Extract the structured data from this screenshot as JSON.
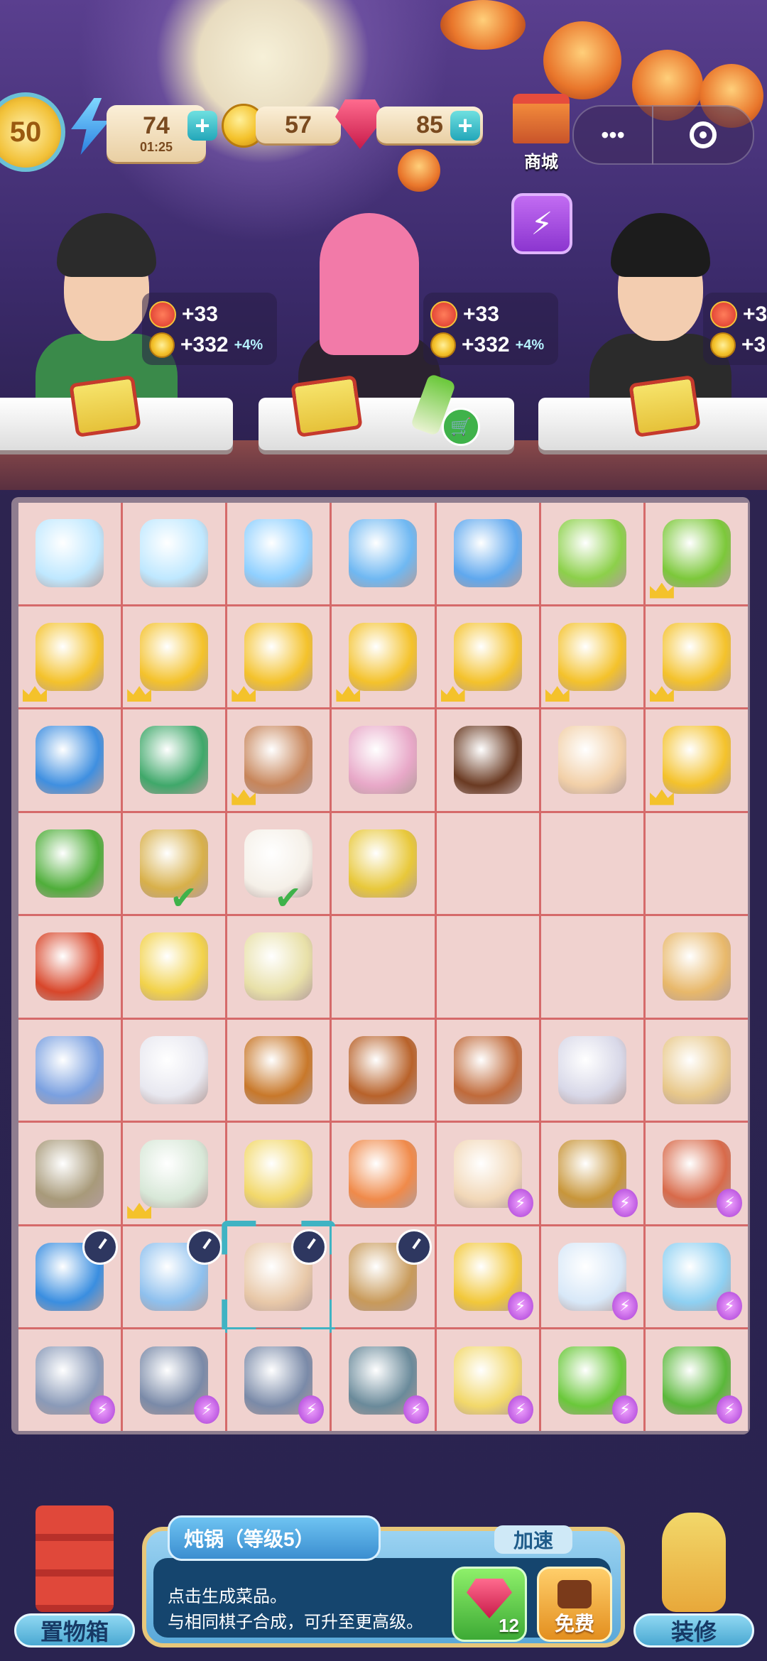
{
  "hud": {
    "level": "50",
    "energy": "74",
    "energy_timer": "01:25",
    "coins": "57",
    "gems": "85",
    "shop_label": "商城",
    "menu_dots": "•••"
  },
  "customers": [
    {
      "envelope_bonus": "+33",
      "coin_bonus": "+332",
      "coin_pct": "+4%"
    },
    {
      "envelope_bonus": "+33",
      "coin_bonus": "+332",
      "coin_pct": "+4%"
    },
    {
      "envelope_bonus": "+3",
      "coin_bonus": "+3",
      "coin_pct": ""
    }
  ],
  "board": {
    "rows": [
      [
        {
          "i": "ice-cube-icon",
          "c": "#bfe8ff"
        },
        {
          "i": "ice-cubes-icon",
          "c": "#bfe8ff"
        },
        {
          "i": "ice-bowl-icon",
          "c": "#8fd0ff"
        },
        {
          "i": "ice-bucket-icon",
          "c": "#6fb8f2"
        },
        {
          "i": "ice-cooler-icon",
          "c": "#5fa8ee"
        },
        {
          "i": "juicer-icon",
          "c": "#8cd04a"
        },
        {
          "i": "lime-icon",
          "c": "#7cc83a",
          "crown": true
        }
      ],
      [
        {
          "i": "coin-stack-icon",
          "c": "#f4c22b",
          "crown": true
        },
        {
          "i": "coin-stack-icon",
          "c": "#f4c22b",
          "crown": true
        },
        {
          "i": "coin-stack-icon",
          "c": "#f4c22b",
          "crown": true
        },
        {
          "i": "coin-stack-icon",
          "c": "#f4c22b",
          "crown": true
        },
        {
          "i": "coin-stack-icon",
          "c": "#f4c22b",
          "crown": true
        },
        {
          "i": "coin-stack-icon",
          "c": "#f4c22b",
          "crown": true
        },
        {
          "i": "coin-stack-icon",
          "c": "#f4c22b",
          "crown": true
        }
      ],
      [
        {
          "i": "blue-orb-icon",
          "c": "#3f8fe0"
        },
        {
          "i": "green-orb-icon",
          "c": "#3fa86a"
        },
        {
          "i": "dessert-bowl-icon",
          "c": "#c7855a",
          "crown": true
        },
        {
          "i": "fruit-bowl-icon",
          "c": "#e8a8c8"
        },
        {
          "i": "chocolate-sundae-icon",
          "c": "#6a3a22"
        },
        {
          "i": "ice-cream-cone-icon",
          "c": "#f2d0a8"
        },
        {
          "i": "coin-stack-icon",
          "c": "#f4c22b",
          "crown": true
        }
      ],
      [
        {
          "i": "okra-icon",
          "c": "#4fae3a"
        },
        {
          "i": "steamer-dumplings-icon",
          "c": "#d8b04a",
          "check": true
        },
        {
          "i": "steamed-bun-icon",
          "c": "#f5f0e8",
          "check": true
        },
        {
          "i": "corn-icon",
          "c": "#e8c83a"
        },
        {
          "i": "",
          "c": ""
        },
        {
          "i": "",
          "c": ""
        },
        {
          "i": "",
          "c": ""
        }
      ],
      [
        {
          "i": "crayfish-dish-icon",
          "c": "#d8462a"
        },
        {
          "i": "cake-slice-icon",
          "c": "#f2d24a"
        },
        {
          "i": "layer-cake-icon",
          "c": "#e8e0a8"
        },
        {
          "i": "",
          "c": ""
        },
        {
          "i": "",
          "c": ""
        },
        {
          "i": "",
          "c": ""
        },
        {
          "i": "taco-icon",
          "c": "#e8b86a"
        }
      ],
      [
        {
          "i": "teapot-icon",
          "c": "#7aa0e0"
        },
        {
          "i": "tea-bowl-icon",
          "c": "#e8e8f0"
        },
        {
          "i": "roast-chicken-icon",
          "c": "#c8782a"
        },
        {
          "i": "roast-meat-icon",
          "c": "#b8622a"
        },
        {
          "i": "sliced-roast-icon",
          "c": "#c06a3a"
        },
        {
          "i": "bento-box-icon",
          "c": "#d8d8e8"
        },
        {
          "i": "burrito-icon",
          "c": "#e8c88a"
        }
      ],
      [
        {
          "i": "oyster-plate-icon",
          "c": "#a89a7a"
        },
        {
          "i": "tea-set-icon",
          "c": "#d8e8d8",
          "crown": true
        },
        {
          "i": "soup-bowl-icon",
          "c": "#f2d86a"
        },
        {
          "i": "peach-icon",
          "c": "#f08a4a"
        },
        {
          "i": "paper-bag-icon",
          "c": "#f2d8b8",
          "bolt": true
        },
        {
          "i": "corn-basket-icon",
          "c": "#c8963a",
          "bolt": true
        },
        {
          "i": "vegetable-basket-icon",
          "c": "#d86a4a",
          "bolt": true
        }
      ],
      [
        {
          "i": "fridge-icon",
          "c": "#3a8ee0",
          "timer": true
        },
        {
          "i": "freezer-icon",
          "c": "#8ec0ee",
          "timer": true
        },
        {
          "i": "clay-pot-icon",
          "c": "#e8c8a8",
          "timer": true,
          "selected": true
        },
        {
          "i": "stew-pot-icon",
          "c": "#c89a5a",
          "timer": true
        },
        {
          "i": "water-bucket-icon",
          "c": "#f2c83a",
          "bolt": true
        },
        {
          "i": "fish-bag-icon",
          "c": "#d8e8f8",
          "bolt": true
        },
        {
          "i": "fish-bowl-icon",
          "c": "#8ed0f2",
          "bolt": true
        }
      ],
      [
        {
          "i": "cherry-plate-icon",
          "c": "#8a9ab8",
          "bolt": true
        },
        {
          "i": "cherry-basket-icon",
          "c": "#7a8aa8",
          "bolt": true
        },
        {
          "i": "cherry-basket-icon",
          "c": "#7a8aa8",
          "bolt": true
        },
        {
          "i": "cherry-basket-icon",
          "c": "#6a8a9a",
          "bolt": true
        },
        {
          "i": "blender-icon",
          "c": "#f2d86a",
          "bolt": true
        },
        {
          "i": "juice-maker-icon",
          "c": "#6ac83a",
          "bolt": true
        },
        {
          "i": "coffee-machine-icon",
          "c": "#5ab83a",
          "bolt": true
        }
      ]
    ]
  },
  "info_panel": {
    "title": "炖锅（等级5）",
    "line1": "点击生成菜品。",
    "line2": "与相同棋子合成，可升至更高级。",
    "speed_label": "加速",
    "gem_cost": "12",
    "free_label": "免费"
  },
  "storage_label": "置物箱",
  "decorate_label": "装修",
  "colors": {
    "board_line": "#d56a6a",
    "cell_bg": "#f0d2cf",
    "accent_teal": "#3fb3c3"
  }
}
